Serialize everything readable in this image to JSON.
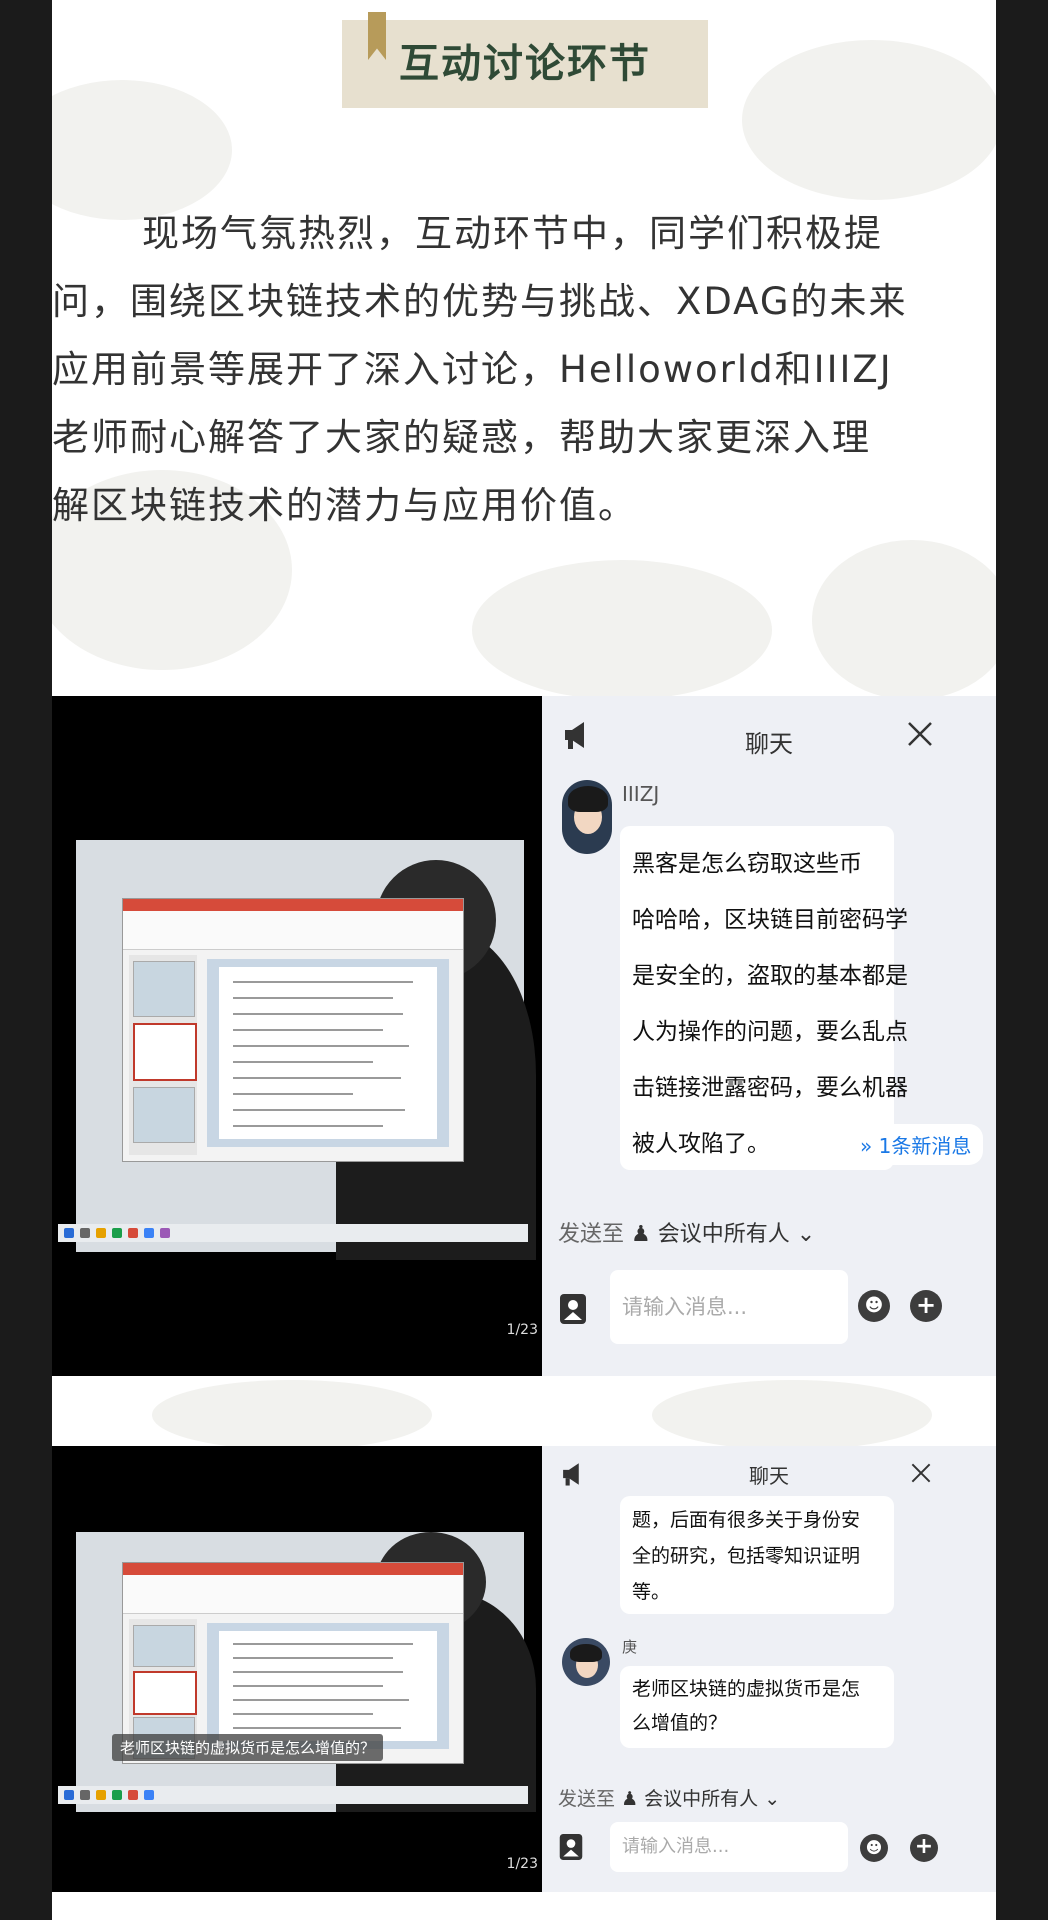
{
  "header": {
    "title": "互动讨论环节"
  },
  "article": {
    "lines": [
      "现场气氛热烈，互动环节中，同学们积极提",
      "问，围绕区块链技术的优势与挑战、XDAG的未来",
      "应用前景等展开了深入讨论，Helloworld和IIIZJ",
      "老师耐心解答了大家的疑惑，帮助大家更深入理",
      "解区块链技术的潜力与应用价值。"
    ]
  },
  "screenshot1": {
    "page_count": "1/23",
    "chat": {
      "title": "聊天",
      "sender": "IIIZJ",
      "message_lines": [
        "黑客是怎么窃取这些币",
        "哈哈哈，区块链目前密码学",
        "是安全的，盗取的基本都是",
        "人为操作的问题，要么乱点",
        "击链接泄露密码，要么机器",
        "被人攻陷了。"
      ],
      "new_messages": "1条新消息",
      "send_to_label": "发送至",
      "send_to_value": "会议中所有人",
      "input_placeholder": "请输入消息..."
    }
  },
  "screenshot2": {
    "page_count": "1/23",
    "caption": "老师区块链的虚拟货币是怎么增值的？",
    "chat": {
      "title": "聊天",
      "prev_message_lines": [
        "题，后面有很多关于身份安",
        "全的研究，包括零知识证明",
        "等。"
      ],
      "sender": "庚",
      "message_lines": [
        "老师区块链的虚拟货币是怎",
        "么增值的？"
      ],
      "send_to_label": "发送至",
      "send_to_value": "会议中所有人",
      "input_placeholder": "请输入消息..."
    }
  },
  "colors": {
    "banner_bg": "#e7e0cf",
    "banner_text": "#2f4a36",
    "flag": "#b79b5a",
    "link_blue": "#1a78e6"
  }
}
